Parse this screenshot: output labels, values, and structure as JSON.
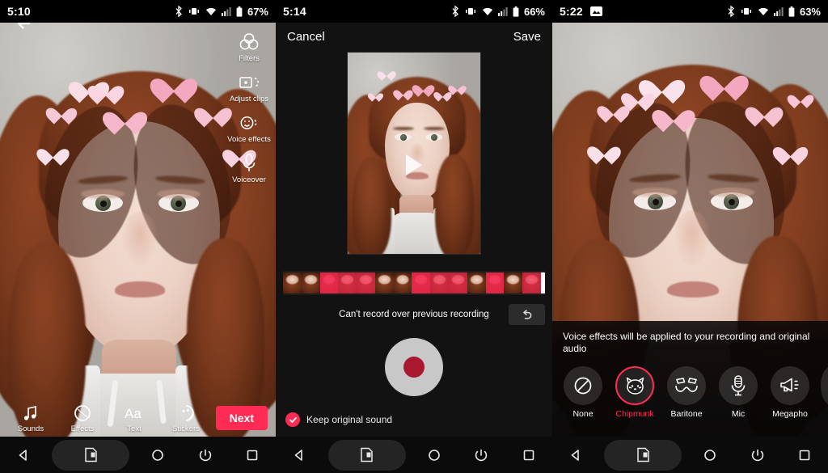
{
  "panels": [
    {
      "id": "capture",
      "status": {
        "time": "5:10",
        "battery": "67%",
        "icons": [
          "bluetooth-icon",
          "vibrate-icon",
          "wifi-icon",
          "signal-icon",
          "battery-icon"
        ],
        "screenshot_icon": false
      },
      "back_label": "Back",
      "right_rail": [
        {
          "label": "Filters",
          "icon": "filters-icon"
        },
        {
          "label": "Adjust clips",
          "icon": "adjust-clips-icon"
        },
        {
          "label": "Voice effects",
          "icon": "voice-effects-icon"
        },
        {
          "label": "Voiceover",
          "icon": "microphone-icon"
        }
      ],
      "bottom_bar": [
        {
          "label": "Sounds",
          "icon": "music-note-icon"
        },
        {
          "label": "Effects",
          "icon": "effects-icon"
        },
        {
          "label": "Text",
          "icon": "text-aa-icon"
        },
        {
          "label": "Stickers",
          "icon": "stickers-icon"
        }
      ],
      "next_label": "Next",
      "accent": "#FE2C55"
    },
    {
      "id": "voiceover-editor",
      "status": {
        "time": "5:14",
        "battery": "66%",
        "screenshot_icon": false
      },
      "cancel_label": "Cancel",
      "save_label": "Save",
      "message": "Can't record over previous recording",
      "undo_icon": "undo-icon",
      "record_icon": "record-button",
      "keep_sound_label": "Keep original sound",
      "keep_sound_checked": true,
      "timeline_segments": [
        {
          "type": "frame"
        },
        {
          "type": "frame"
        },
        {
          "type": "recorded"
        },
        {
          "type": "recorded"
        },
        {
          "type": "recorded"
        },
        {
          "type": "frame"
        },
        {
          "type": "frame"
        },
        {
          "type": "recorded"
        },
        {
          "type": "recorded"
        },
        {
          "type": "recorded"
        },
        {
          "type": "frame"
        },
        {
          "type": "frame"
        },
        {
          "type": "recorded"
        },
        {
          "type": "recorded"
        }
      ]
    },
    {
      "id": "voice-effects",
      "status": {
        "time": "5:22",
        "battery": "63%",
        "screenshot_icon": true
      },
      "note": "Voice effects will be applied to your recording and original audio",
      "effects": [
        {
          "label": "None",
          "icon": "no-effect-icon",
          "selected": false
        },
        {
          "label": "Chipmunk",
          "icon": "chipmunk-icon",
          "selected": true
        },
        {
          "label": "Baritone",
          "icon": "mustache-icon",
          "selected": false
        },
        {
          "label": "Mic",
          "icon": "microphone-icon",
          "selected": false
        },
        {
          "label": "Megapho",
          "icon": "megaphone-icon",
          "selected": false
        }
      ],
      "accent": "#FE2C55"
    }
  ],
  "navbar": {
    "items": [
      {
        "name": "back",
        "icon": "nav-back-triangle-icon"
      },
      {
        "name": "screenshot",
        "icon": "nav-screenshot-icon"
      },
      {
        "name": "home",
        "icon": "nav-home-circle-icon"
      },
      {
        "name": "power",
        "icon": "nav-power-icon"
      },
      {
        "name": "recents",
        "icon": "nav-recents-square-icon"
      }
    ]
  }
}
